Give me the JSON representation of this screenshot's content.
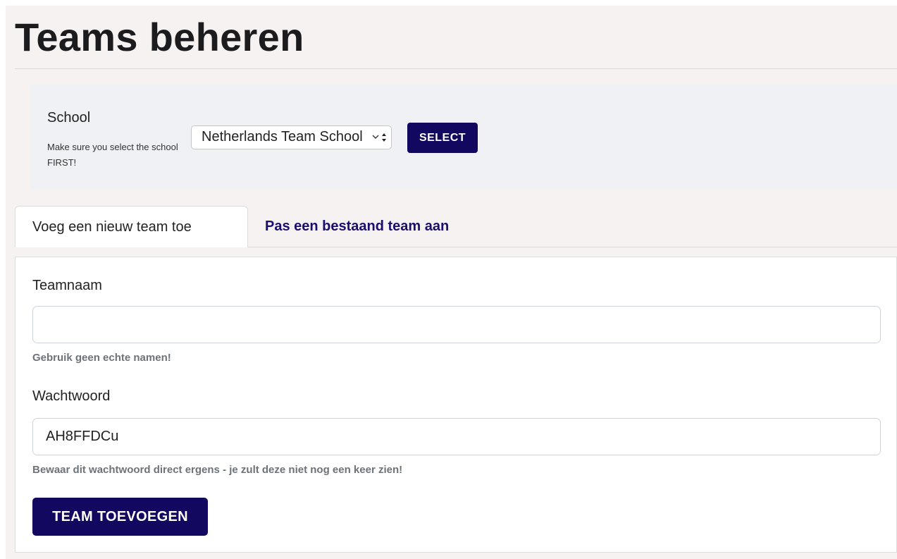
{
  "page": {
    "title": "Teams beheren"
  },
  "school": {
    "label": "School",
    "hint": "Make sure you select the school FIRST!",
    "selected_value": "Netherlands Team School",
    "select_button": "SELECT"
  },
  "tabs": [
    {
      "label": "Voeg een nieuw team toe",
      "active": true
    },
    {
      "label": "Pas een bestaand team aan",
      "active": false
    }
  ],
  "form": {
    "team_name": {
      "label": "Teamnaam",
      "value": "",
      "help": "Gebruik geen echte namen!"
    },
    "password": {
      "label": "Wachtwoord",
      "value": "AH8FFDCu",
      "help": "Bewaar dit wachtwoord direct ergens - je zult deze niet nog een keer zien!"
    },
    "submit_label": "TEAM TOEVOEGEN"
  },
  "colors": {
    "primary": "#130860",
    "tab_link": "#1a0f6e",
    "page_background": "#f6f2f1",
    "school_panel_background": "#f0f1f5",
    "help_text": "#6c737a"
  },
  "icons": {
    "select_arrows": "chevron-updown-icon"
  }
}
